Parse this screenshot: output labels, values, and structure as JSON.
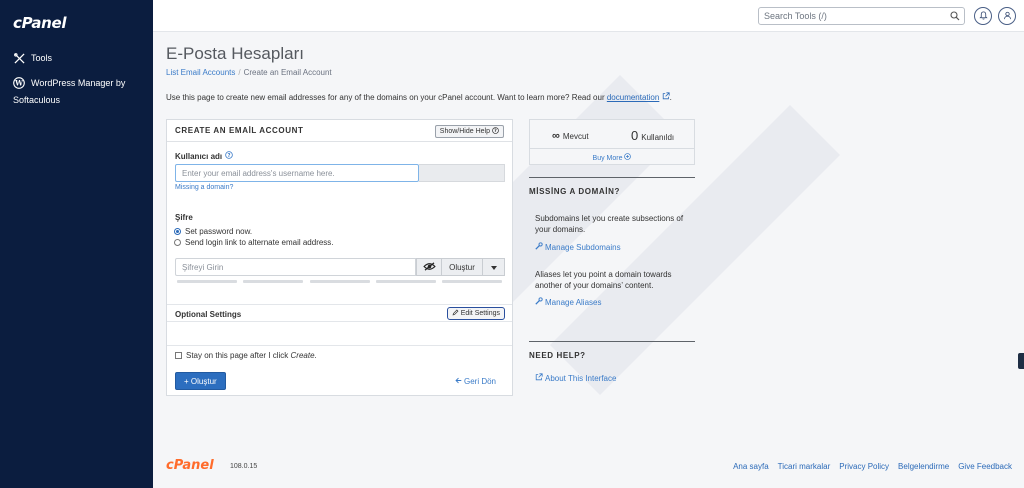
{
  "brand": {
    "logo_text": "cPanel"
  },
  "sidebar": {
    "items": [
      {
        "label": "Tools",
        "icon": "tools-icon"
      },
      {
        "label": "WordPress Manager by",
        "label_line2": "Softaculous",
        "icon": "wordpress-icon"
      }
    ]
  },
  "topbar": {
    "search_placeholder": "Search Tools (/)"
  },
  "page": {
    "title": "E-Posta Hesapları",
    "breadcrumb": {
      "parent": "List Email Accounts",
      "separator": "/",
      "current": "Create an Email Account"
    },
    "intro": "Use this page to create new email addresses for any of the domains on your cPanel account. Want to learn more? Read our",
    "intro_link": "documentation",
    "intro_end": "."
  },
  "form": {
    "title": "CREATE AN EMAİL ACCOUNT",
    "help_button": "Show/Hide Help",
    "username_label": "Kullanıcı adı",
    "username_placeholder": "Enter your email address's username here.",
    "missing_domain_link": "Missing a domain?",
    "password_label": "Şifre",
    "radio_set_now": "Set password now.",
    "radio_send_link": "Send login link to alternate email address.",
    "password_placeholder": "Şifreyi Girin",
    "generate_button": "Oluştur",
    "optional_settings": "Optional Settings",
    "edit_settings": "Edit Settings",
    "stay_label": "Stay on this page after I click",
    "stay_label_em": "Create",
    "stay_label_end": ".",
    "create_button": "+ Oluştur",
    "back_link": "Geri Dön"
  },
  "stats": {
    "available_symbol": "∞",
    "available_label": "Mevcut",
    "used_count": "0",
    "used_label": "Kullanıldı",
    "buy_more": "Buy More"
  },
  "missing_domain": {
    "heading": "MİSSİNG A DOMAİN?",
    "subdomains_text": "Subdomains let you create subsections of your domains.",
    "subdomains_link": "Manage Subdomains",
    "aliases_text": "Aliases let you point a domain towards another of your domains’ content.",
    "aliases_link": "Manage Aliases"
  },
  "need_help": {
    "heading": "NEED HELP?",
    "link": "About This Interface"
  },
  "footer": {
    "logo_text": "cPanel",
    "version": "108.0.15",
    "links": [
      "Ana sayfa",
      "Ticari markalar",
      "Privacy Policy",
      "Belgelendirme",
      "Give Feedback"
    ]
  },
  "colors": {
    "sidebar_bg": "#0b1d3f",
    "accent": "#2c6ebf",
    "link": "#3a7bc8",
    "footer_logo": "#ff6c2c"
  }
}
